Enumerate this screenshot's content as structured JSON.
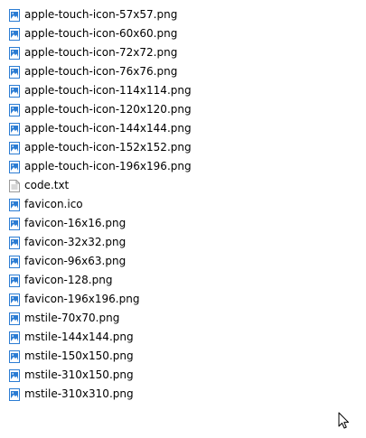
{
  "files": [
    {
      "name": "apple-touch-icon-57x57.png",
      "icon": "image-file-icon"
    },
    {
      "name": "apple-touch-icon-60x60.png",
      "icon": "image-file-icon"
    },
    {
      "name": "apple-touch-icon-72x72.png",
      "icon": "image-file-icon"
    },
    {
      "name": "apple-touch-icon-76x76.png",
      "icon": "image-file-icon"
    },
    {
      "name": "apple-touch-icon-114x114.png",
      "icon": "image-file-icon"
    },
    {
      "name": "apple-touch-icon-120x120.png",
      "icon": "image-file-icon"
    },
    {
      "name": "apple-touch-icon-144x144.png",
      "icon": "image-file-icon"
    },
    {
      "name": "apple-touch-icon-152x152.png",
      "icon": "image-file-icon"
    },
    {
      "name": "apple-touch-icon-196x196.png",
      "icon": "image-file-icon"
    },
    {
      "name": "code.txt",
      "icon": "text-file-icon"
    },
    {
      "name": "favicon.ico",
      "icon": "image-file-icon"
    },
    {
      "name": "favicon-16x16.png",
      "icon": "image-file-icon"
    },
    {
      "name": "favicon-32x32.png",
      "icon": "image-file-icon"
    },
    {
      "name": "favicon-96x63.png",
      "icon": "image-file-icon"
    },
    {
      "name": "favicon-128.png",
      "icon": "image-file-icon"
    },
    {
      "name": "favicon-196x196.png",
      "icon": "image-file-icon"
    },
    {
      "name": "mstile-70x70.png",
      "icon": "image-file-icon"
    },
    {
      "name": "mstile-144x144.png",
      "icon": "image-file-icon"
    },
    {
      "name": "mstile-150x150.png",
      "icon": "image-file-icon"
    },
    {
      "name": "mstile-310x150.png",
      "icon": "image-file-icon"
    },
    {
      "name": "mstile-310x310.png",
      "icon": "image-file-icon"
    }
  ],
  "cursor": {
    "icon": "mouse-pointer-icon"
  },
  "colors": {
    "background": "#ffffff",
    "text": "#000000",
    "image_icon_accent": "#2b7cd3",
    "text_icon_outline": "#9a9a9a"
  }
}
